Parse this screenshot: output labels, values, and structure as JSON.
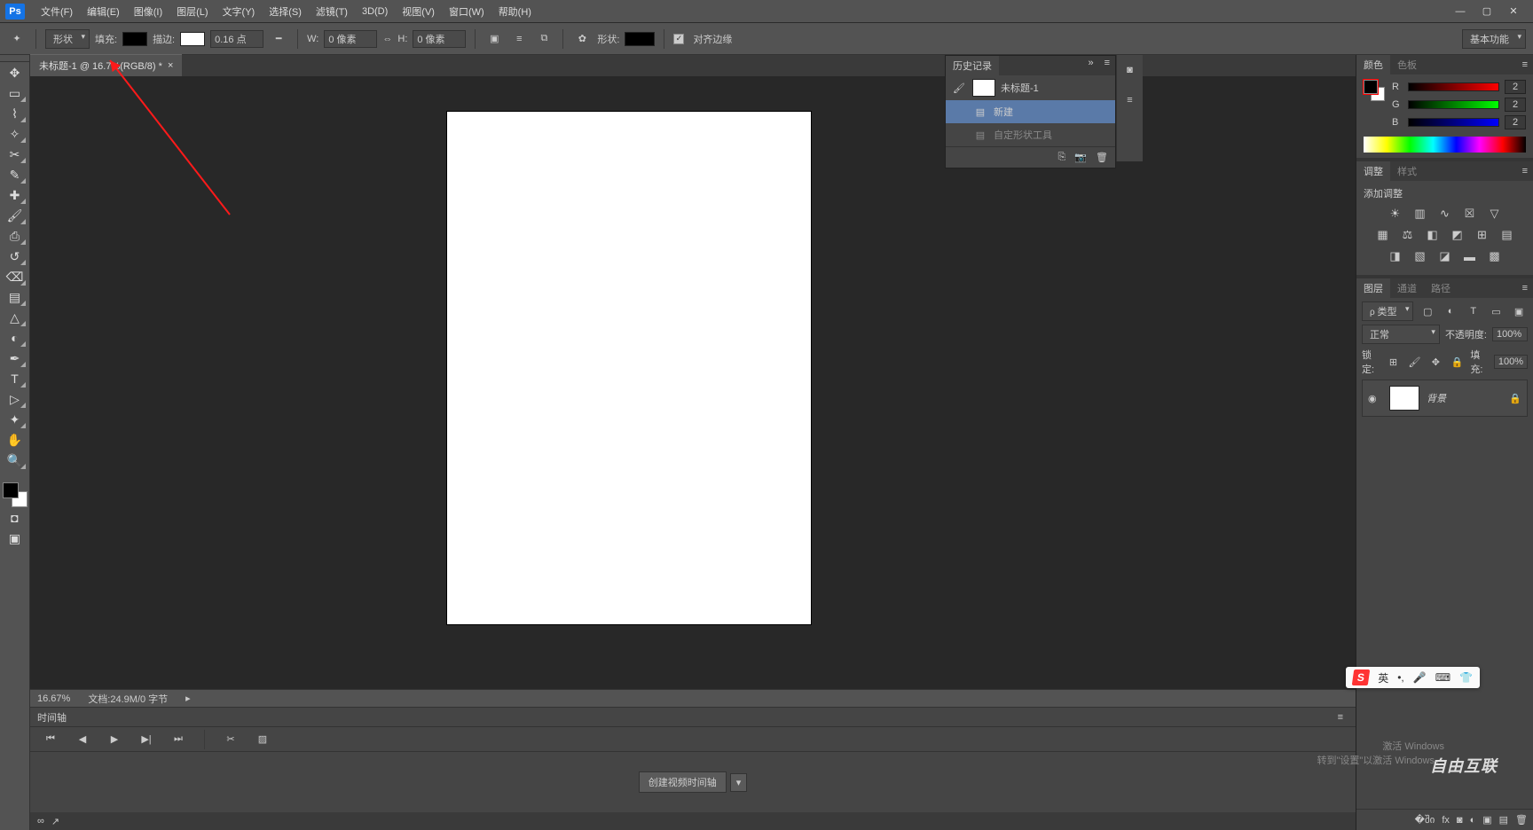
{
  "app": {
    "logo": "Ps"
  },
  "menus": [
    "文件(F)",
    "编辑(E)",
    "图像(I)",
    "图层(L)",
    "文字(Y)",
    "选择(S)",
    "滤镜(T)",
    "3D(D)",
    "视图(V)",
    "窗口(W)",
    "帮助(H)"
  ],
  "options": {
    "shape_mode": "形状",
    "fill_label": "填充:",
    "stroke_label": "描边:",
    "stroke_width": "0.16 点",
    "w_label": "W:",
    "w_value": "0 像素",
    "h_label": "H:",
    "h_value": "0 像素",
    "shape_label": "形状:",
    "align_edges": "对齐边缘",
    "workspace": "基本功能"
  },
  "document": {
    "tab_title": "未标题-1 @ 16.7%(RGB/8) *",
    "zoom": "16.67%",
    "doc_info": "文档:24.9M/0 字节"
  },
  "timeline": {
    "title": "时间轴",
    "create_button": "创建视频时间轴"
  },
  "history": {
    "title": "历史记录",
    "doc_name": "未标题-1",
    "entries": [
      "新建",
      "自定形状工具"
    ]
  },
  "color_panel": {
    "tabs": [
      "颜色",
      "色板"
    ],
    "r_label": "R",
    "g_label": "G",
    "b_label": "B",
    "r_value": "2",
    "g_value": "2",
    "b_value": "2"
  },
  "adjustments": {
    "tabs": [
      "调整",
      "样式"
    ],
    "add_label": "添加调整"
  },
  "layers": {
    "tabs": [
      "图层",
      "通道",
      "路径"
    ],
    "kind_filter": "类型",
    "blend_mode": "正常",
    "opacity_label": "不透明度:",
    "opacity_value": "100%",
    "lock_label": "锁定:",
    "fill_label": "填充:",
    "fill_value": "100%",
    "layer_name": "背景"
  },
  "windows_watermark": {
    "line1": "激活 Windows",
    "line2": "转到\"设置\"以激活 Windows。"
  },
  "logo_watermark": "自由互联",
  "ime": {
    "lang": "英",
    "sep": "•,"
  }
}
